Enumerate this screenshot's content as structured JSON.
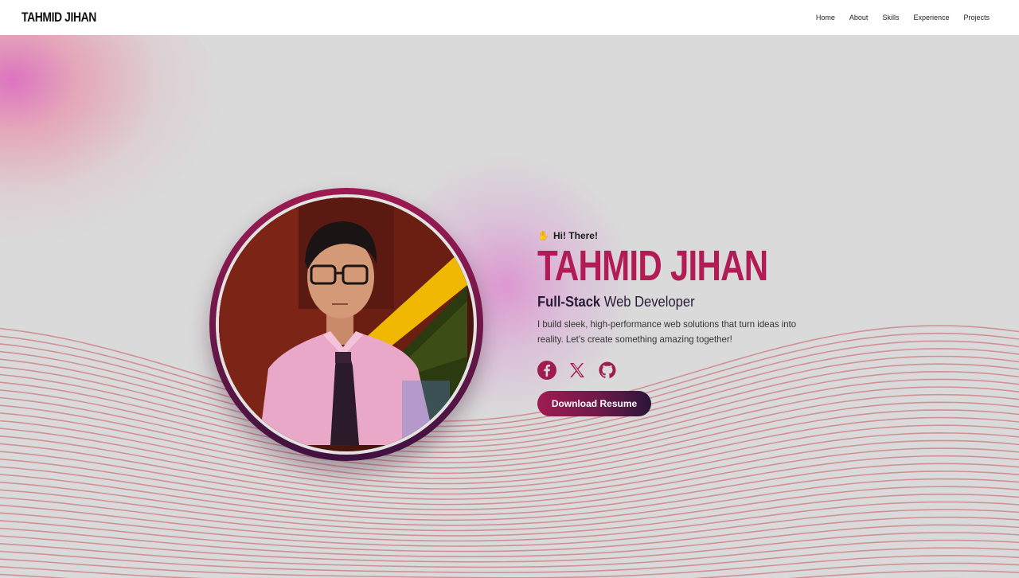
{
  "navbar": {
    "brand": "TAHMID JIHAN",
    "links": [
      "Home",
      "About",
      "Skills",
      "Experience",
      "Projects"
    ]
  },
  "hero": {
    "greeting": "Hi! There!",
    "name": "TAHMID JIHAN",
    "role_strong": "Full-Stack",
    "role_rest": " Web Developer",
    "bio": "I build sleek, high-performance web solutions that turn ideas into reality. Let’s create something amazing together!",
    "resume_button": "Download Resume",
    "social_icons": [
      "facebook-icon",
      "x-icon",
      "github-icon"
    ]
  },
  "colors": {
    "accent": "#b21b55",
    "accent_dark": "#2a1538",
    "wave_lines": "#cf8a8e",
    "background": "#dadada"
  }
}
